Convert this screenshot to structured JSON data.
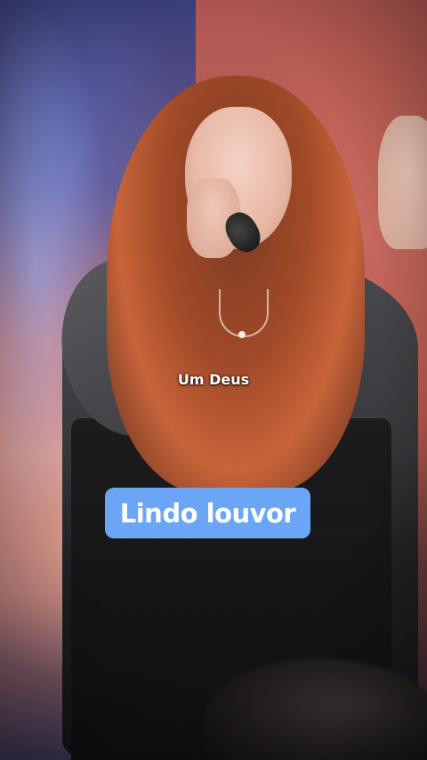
{
  "video": {
    "lyric_line": "Um Deus",
    "caption_badge": "Lindo louvor"
  },
  "colors": {
    "caption_badge_bg": "#6aa6f5",
    "caption_text": "#ffffff"
  }
}
